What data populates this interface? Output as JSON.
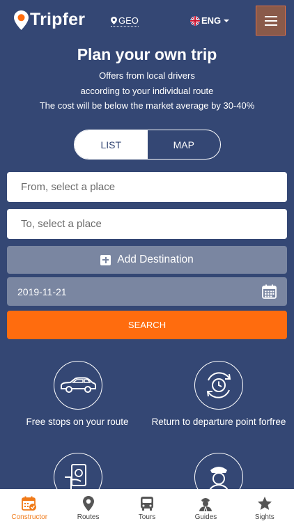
{
  "header": {
    "logo_text": "Tripfer",
    "geo_label": "GEO",
    "lang_label": "ENG"
  },
  "hero": {
    "title": "Plan your own trip",
    "subtitle_lines": [
      "Offers from local drivers",
      "according to your individual route",
      "The cost will be below the market average by 30-40%"
    ]
  },
  "toggle": {
    "list_label": "LIST",
    "map_label": "MAP",
    "active": "LIST"
  },
  "form": {
    "from_placeholder": "From, select a place",
    "to_placeholder": "To, select a place",
    "add_destination_label": "Add Destination",
    "date_value": "2019-11-21",
    "search_label": "SEARCH"
  },
  "features": [
    {
      "label": "Free stops on your route",
      "icon": "car-icon"
    },
    {
      "label": "Return to departure point forfree",
      "icon": "return-clock-icon"
    },
    {
      "label": "",
      "icon": "payment-icon"
    },
    {
      "label": "",
      "icon": "driver-icon"
    }
  ],
  "bottom_nav": [
    {
      "label": "Constructor",
      "icon": "calendar-icon",
      "active": true
    },
    {
      "label": "Routes",
      "icon": "map-pin-icon",
      "active": false
    },
    {
      "label": "Tours",
      "icon": "bus-icon",
      "active": false
    },
    {
      "label": "Guides",
      "icon": "guide-icon",
      "active": false
    },
    {
      "label": "Sights",
      "icon": "star-icon",
      "active": false
    }
  ],
  "colors": {
    "background": "#344774",
    "accent": "#ff6c0e",
    "muted_field": "#7a86a1",
    "active_nav": "#f07a18"
  }
}
